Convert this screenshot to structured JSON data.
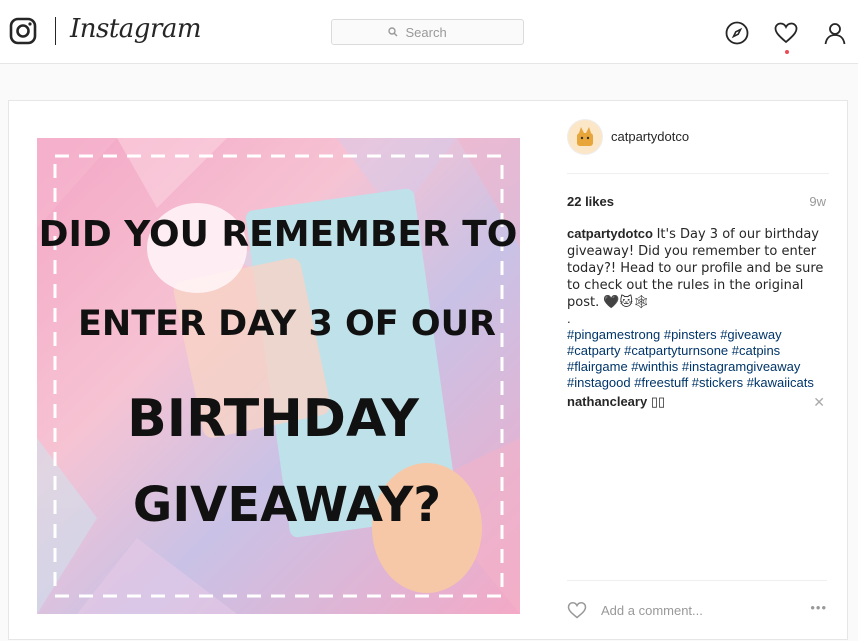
{
  "header": {
    "wordmark": "Instagram",
    "search_placeholder": "Search",
    "icons": [
      "instagram-glyph-icon",
      "compass-icon",
      "heart-icon",
      "profile-icon",
      "search-icon"
    ],
    "notification_color": "#ed4956"
  },
  "post": {
    "image_text": {
      "line1": "DID YOU REMEMBER TO",
      "line2": "ENTER DAY 3 OF OUR",
      "line3": "BIRTHDAY",
      "line4": "GIVEAWAY?"
    },
    "author": "catpartydotco",
    "likes": "22 likes",
    "time": "9w",
    "caption_author": "catpartydotco",
    "caption_text": "It's Day 3 of our birthday giveaway! Did you remember to enter today?! Head to our profile and be sure to check out the rules in the original post. 🖤🐱🕸",
    "caption_dot": ".",
    "hashtags": "#pingamestrong #pinsters #giveaway #catparty #catpartyturnsone #catpins #flairgame #winthis #instagramgiveaway #instagood #freestuff #stickers #kawaiicats",
    "comment_user": "nathancleary",
    "comment_text": "▯▯",
    "add_comment_placeholder": "Add a comment...",
    "more_label": "•••",
    "close_label": "✕"
  }
}
